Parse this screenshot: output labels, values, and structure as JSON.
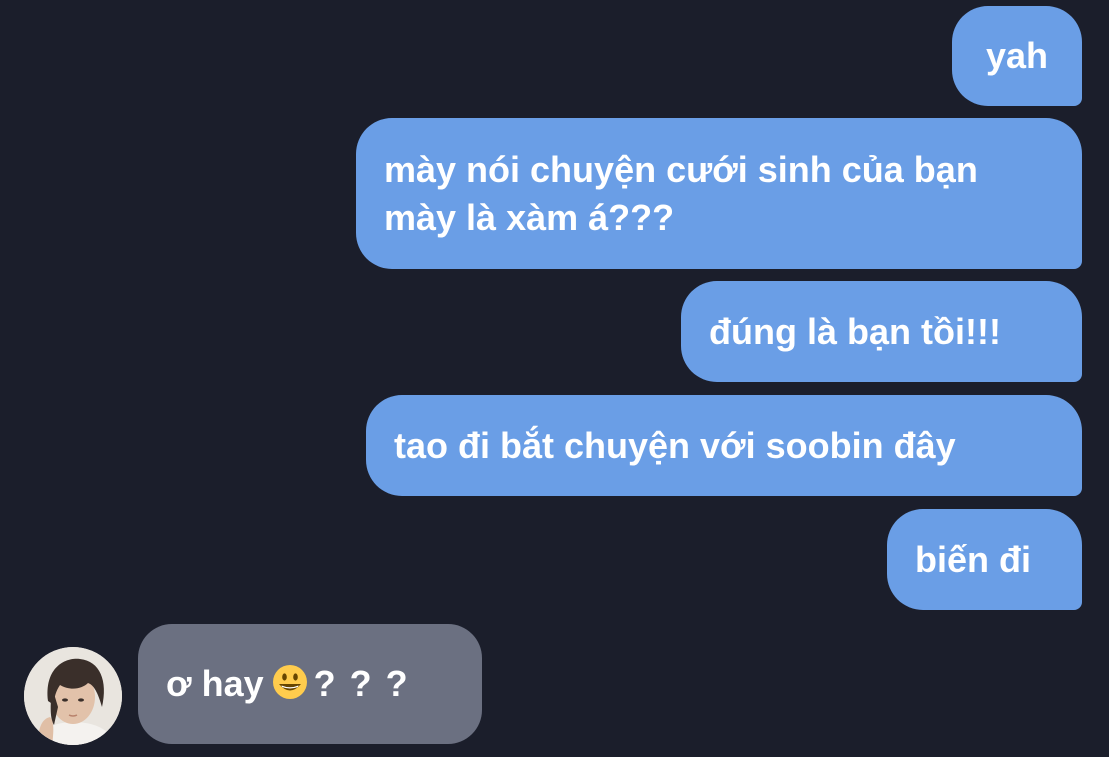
{
  "conversation": {
    "messages": [
      {
        "direction": "outgoing",
        "text": "yah"
      },
      {
        "direction": "outgoing",
        "text": "mày nói chuyện cưới sinh của bạn mày là xàm á???"
      },
      {
        "direction": "outgoing",
        "text": "đúng là bạn tồi!!!"
      },
      {
        "direction": "outgoing",
        "text": "tao đi bắt chuyện với soobin đây"
      },
      {
        "direction": "outgoing",
        "text": "biến đi"
      },
      {
        "direction": "incoming",
        "text_before_emoji": "ơ hay",
        "emoji": "grinning-face-emoji",
        "text_after_emoji": "? ? ?"
      }
    ]
  },
  "colors": {
    "background": "#1b1e2b",
    "outgoing_bubble": "#6a9ee6",
    "incoming_bubble": "#6b7081",
    "text": "#ffffff"
  }
}
